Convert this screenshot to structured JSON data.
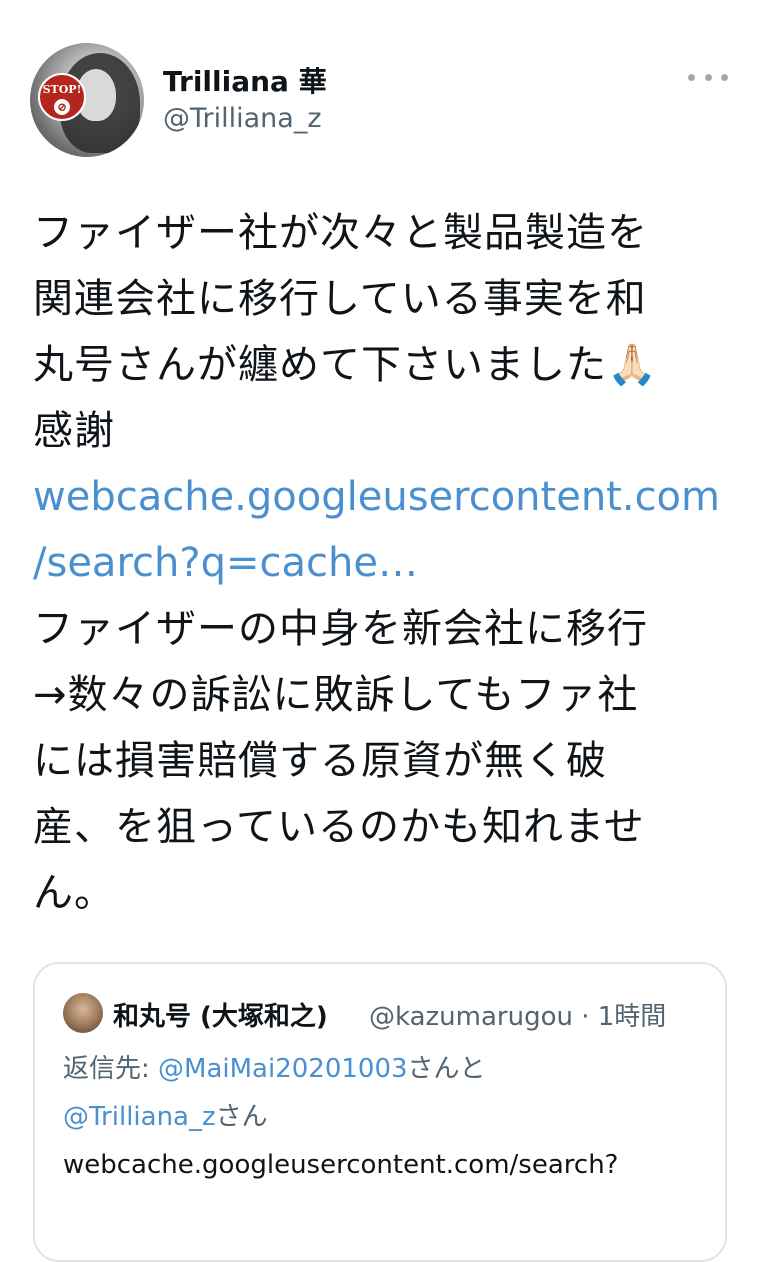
{
  "author": {
    "display_name": "Trilliana 華",
    "handle": "@Trilliana_z",
    "avatar_badge": "STOP!"
  },
  "tweet": {
    "lines": [
      "ファイザー社が次々と製品製造を",
      "関連会社に移行している事実を和",
      "丸号さんが纏めて下さいました🙏🏻",
      "感謝"
    ],
    "link_lines": [
      "webcache.googleusercontent.com",
      "/search?q=cache…"
    ],
    "after_lines": [
      "ファイザーの中身を新会社に移行",
      "→数々の訴訟に敗訴してもファ社",
      "には損害賠償する原資が無く破",
      "産、を狙っているのかも知れませ",
      "ん。"
    ]
  },
  "quote": {
    "name": "和丸号 (大塚和之)",
    "handle_time": "@kazumarugou · 1時間",
    "reply_prefix": "返信先: ",
    "reply_mention_1": "@MaiMai20201003",
    "reply_joiner": "さんと",
    "reply_mention_2": "@Trilliana_z",
    "reply_suffix": "さん",
    "text": "webcache.googleusercontent.com/search?"
  },
  "colors": {
    "link": "#4a90d0",
    "secondary": "#536471",
    "badge": "#b3261e"
  }
}
